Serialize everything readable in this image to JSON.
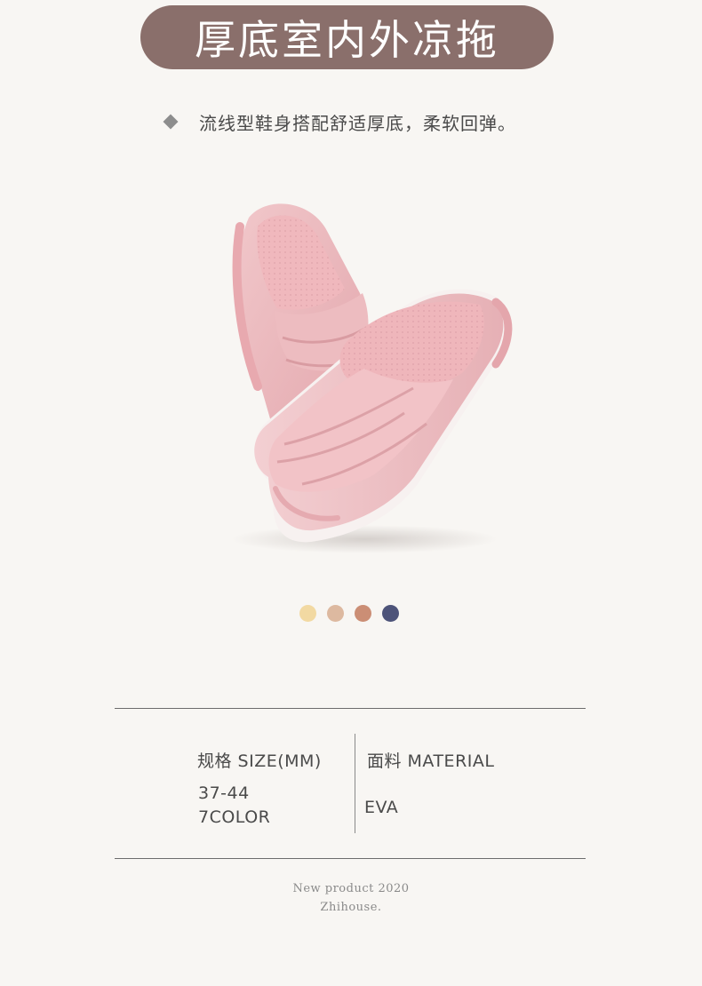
{
  "header": {
    "title": "厚底室内外凉拖"
  },
  "tagline": {
    "bullet_icon": "diamond-icon",
    "text": "流线型鞋身搭配舒适厚底，柔软回弹。"
  },
  "product": {
    "image": "pink-slide-sandals-pair"
  },
  "swatches": [
    {
      "name": "yellow",
      "color": "#f2d9a2"
    },
    {
      "name": "beige",
      "color": "#ddb9a0"
    },
    {
      "name": "terracotta",
      "color": "#cb8e75"
    },
    {
      "name": "navy",
      "color": "#4d5379"
    }
  ],
  "specs": {
    "size_label": "规格 SIZE(MM)",
    "size_range": "37-44",
    "colors": "7COLOR",
    "material_label": "面料 MATERIAL",
    "material_value": "EVA"
  },
  "footer": {
    "line1": "New product 2020",
    "line2": "Zhihouse."
  }
}
